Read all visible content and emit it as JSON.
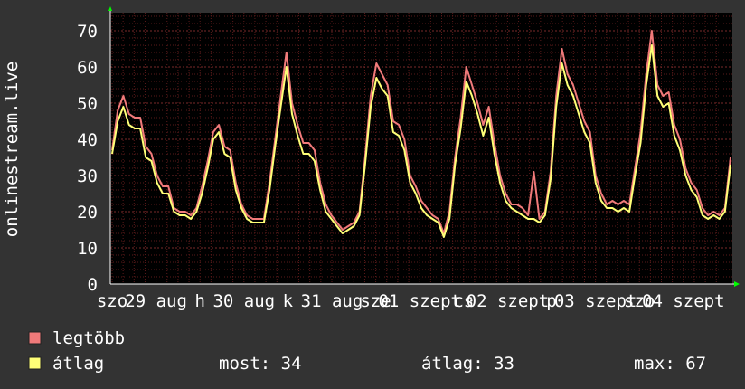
{
  "chart_data": {
    "type": "line",
    "ylabel": "onlinestream.live",
    "ylim": [
      0,
      75
    ],
    "yticks": [
      0,
      10,
      20,
      30,
      40,
      50,
      60,
      70
    ],
    "grid": true,
    "x_tick_labels": [
      "szo",
      "29 aug",
      "h",
      "30 aug",
      "k",
      "31 aug",
      "sze",
      "01 szept",
      "cs",
      "02 szept",
      "p",
      "03 szept",
      "szo",
      "04 szept"
    ],
    "series": [
      {
        "name": "legtöbb",
        "color": "#f07a7a",
        "values": [
          37,
          48,
          52,
          47,
          46,
          46,
          38,
          36,
          30,
          27,
          27,
          21,
          20,
          20,
          19,
          21,
          27,
          34,
          42,
          44,
          38,
          37,
          28,
          22,
          19,
          18,
          18,
          18,
          28,
          40,
          52,
          64,
          50,
          44,
          39,
          39,
          37,
          28,
          22,
          19,
          17,
          15,
          16,
          17,
          20,
          35,
          52,
          61,
          58,
          55,
          45,
          44,
          40,
          30,
          27,
          23,
          21,
          19,
          18,
          14,
          20,
          35,
          46,
          60,
          55,
          50,
          44,
          49,
          39,
          30,
          25,
          22,
          22,
          21,
          19,
          31,
          18,
          20,
          31,
          52,
          65,
          58,
          55,
          50,
          45,
          42,
          30,
          25,
          22,
          23,
          22,
          23,
          22,
          32,
          42,
          58,
          70,
          55,
          52,
          53,
          44,
          40,
          32,
          28,
          26,
          21,
          19,
          20,
          19,
          21,
          35
        ]
      },
      {
        "name": "átlag",
        "color": "#ffff77",
        "values": [
          36,
          45,
          49,
          44,
          43,
          43,
          35,
          34,
          28,
          25,
          25,
          20,
          19,
          19,
          18,
          20,
          25,
          32,
          40,
          42,
          36,
          35,
          26,
          21,
          18,
          17,
          17,
          17,
          26,
          38,
          49,
          60,
          47,
          41,
          36,
          36,
          34,
          26,
          20,
          18,
          16,
          14,
          15,
          16,
          19,
          33,
          49,
          57,
          54,
          52,
          42,
          41,
          37,
          28,
          25,
          21,
          19,
          18,
          17,
          13,
          18,
          33,
          43,
          56,
          52,
          47,
          41,
          46,
          36,
          28,
          23,
          21,
          20,
          19,
          18,
          18,
          17,
          19,
          29,
          49,
          61,
          55,
          52,
          47,
          42,
          39,
          28,
          23,
          21,
          21,
          20,
          21,
          20,
          30,
          39,
          55,
          66,
          52,
          49,
          50,
          41,
          37,
          30,
          26,
          24,
          19,
          18,
          19,
          18,
          20,
          33
        ]
      }
    ]
  },
  "legend": [
    {
      "label": "legtöbb",
      "color": "#f07a7a"
    },
    {
      "label": "átlag",
      "color": "#ffff77"
    }
  ],
  "stats": {
    "most": "most: 34",
    "atlag": "átlag: 33",
    "max": "max: 67"
  }
}
